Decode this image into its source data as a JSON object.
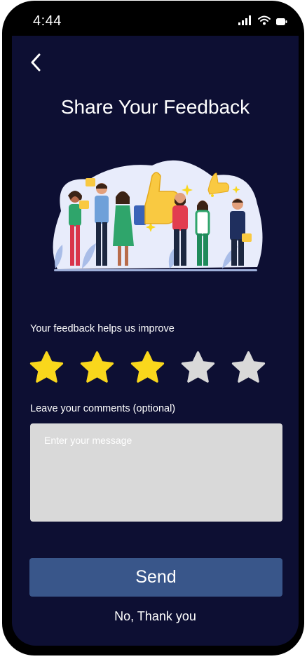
{
  "status_bar": {
    "time": "4:44"
  },
  "icons": {
    "back": "chevron-left-icon",
    "signal": "cellular-signal-icon",
    "wifi": "wifi-icon",
    "battery": "battery-icon"
  },
  "header": {
    "title": "Share Your Feedback"
  },
  "rating": {
    "label": "Your feedback helps us improve",
    "value": 3,
    "max": 5,
    "filled_color": "#f9d71c",
    "empty_color": "#d9d9d9"
  },
  "comments": {
    "label": "Leave your comments (optional)",
    "placeholder": "Enter your message",
    "value": ""
  },
  "actions": {
    "send_label": "Send",
    "decline_label": "No, Thank you"
  },
  "colors": {
    "background": "#0d0f33",
    "primary_button": "#39568a",
    "input_background": "#d9d9d9"
  }
}
